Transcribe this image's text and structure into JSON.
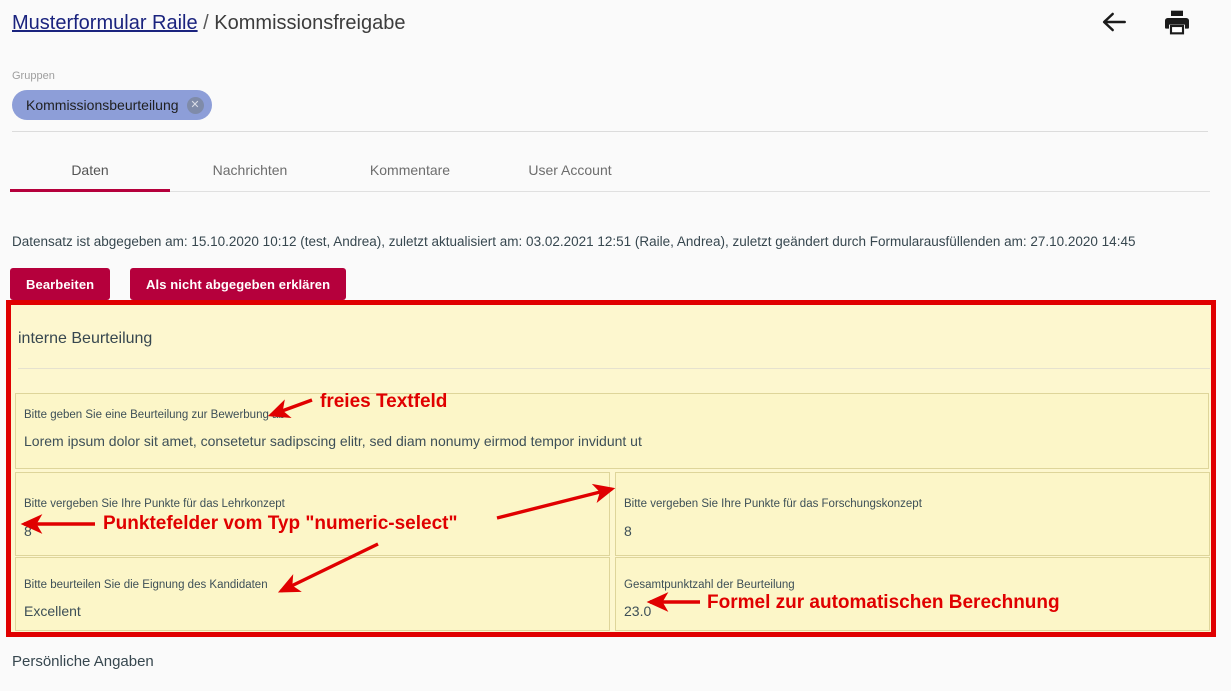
{
  "header": {
    "breadcrumb": {
      "link": "Musterformular Raile",
      "separator": "/",
      "current": "Kommissionsfreigabe"
    },
    "back_icon": "arrow-left-icon",
    "print_icon": "printer-icon"
  },
  "groups": {
    "label": "Gruppen",
    "chip": {
      "label": "Kommissionsbeurteilung",
      "remove_icon": "close-circle-icon"
    }
  },
  "tabs": [
    {
      "label": "Daten",
      "active": true
    },
    {
      "label": "Nachrichten",
      "active": false
    },
    {
      "label": "Kommentare",
      "active": false
    },
    {
      "label": "User Account",
      "active": false
    }
  ],
  "status": {
    "text": "Datensatz ist abgegeben am: 15.10.2020 10:12 (test, Andrea), zuletzt aktualisiert am: 03.02.2021 12:51 (Raile, Andrea), zuletzt geändert durch Formularausfüllenden am: 27.10.2020 14:45"
  },
  "actions": {
    "edit_label": "Bearbeiten",
    "undeclare_label": "Als nicht abgegeben erklären"
  },
  "form": {
    "section_title": "interne Beurteilung",
    "fields": [
      {
        "label": "Bitte geben Sie eine Beurteilung zur Bewerbung ab",
        "value": "Lorem ipsum dolor sit amet, consetetur sadipscing elitr, sed diam nonumy eirmod tempor invidunt ut"
      },
      {
        "label": "Bitte vergeben Sie Ihre Punkte für das Lehrkonzept",
        "value": "8"
      },
      {
        "label": "Bitte vergeben Sie Ihre Punkte für das Forschungskonzept",
        "value": "8"
      },
      {
        "label": "Bitte beurteilen Sie die Eignung des Kandidaten",
        "value": "Excellent"
      },
      {
        "label": "Gesamtpunktzahl der Beurteilung",
        "value": "23.0"
      }
    ]
  },
  "footer": {
    "title": "Persönliche Angaben"
  },
  "annotations": [
    {
      "text": "freies Textfeld"
    },
    {
      "text": "Punktefelder vom Typ \"numeric-select\""
    },
    {
      "text": "Formel zur automatischen Berechnung"
    }
  ],
  "colors": {
    "accent": "#b5003c",
    "annotation": "#e00000",
    "panel_bg": "#fcf6c8",
    "chip_bg": "#8d9ed8",
    "link": "#1a237e"
  }
}
